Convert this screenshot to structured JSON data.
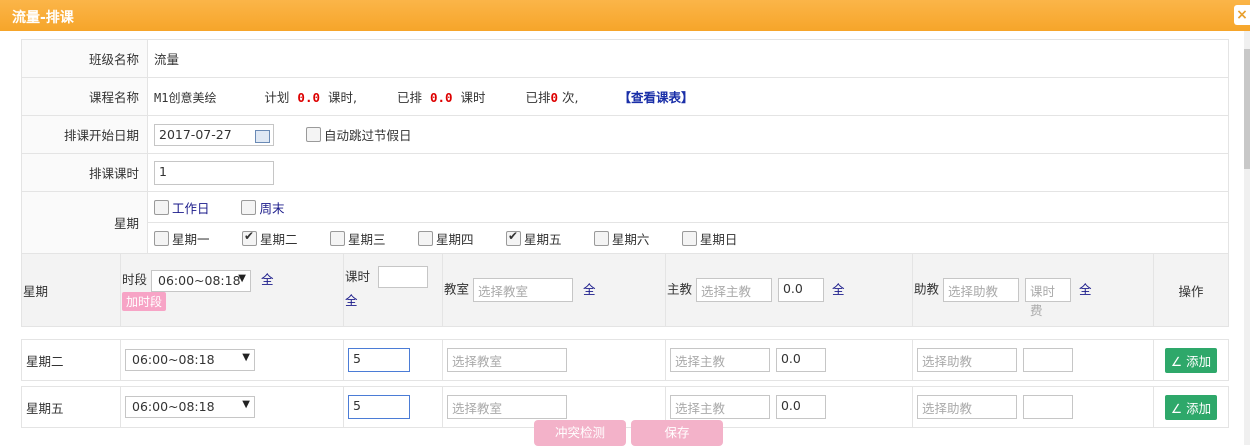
{
  "window": {
    "title": "流量-排课",
    "close": "×"
  },
  "form": {
    "class_name": {
      "label": "班级名称",
      "value": "流量"
    },
    "course": {
      "label": "课程名称",
      "course_value": "M1创意美绘",
      "plan_prefix": "计划",
      "plan_value": "0.0",
      "plan_suffix": "课时,",
      "done_prefix": "已排",
      "done_value": "0.0",
      "done_suffix": "课时",
      "count_prefix": "已排",
      "count_value": "0",
      "count_suffix": "次,",
      "view_link": "【查看课表】"
    },
    "start_date": {
      "label": "排课开始日期",
      "value": "2017-07-27",
      "skip_holiday": "自动跳过节假日"
    },
    "hours": {
      "label": "排课课时",
      "value": "1"
    },
    "week": {
      "label": "星期",
      "quick": [
        {
          "label": "工作日",
          "checked": false
        },
        {
          "label": "周末",
          "checked": false
        }
      ],
      "days": [
        {
          "label": "星期一",
          "checked": false
        },
        {
          "label": "星期二",
          "checked": true
        },
        {
          "label": "星期三",
          "checked": false
        },
        {
          "label": "星期四",
          "checked": false
        },
        {
          "label": "星期五",
          "checked": true
        },
        {
          "label": "星期六",
          "checked": false
        },
        {
          "label": "星期日",
          "checked": false
        }
      ]
    }
  },
  "grid": {
    "header": {
      "weekday": "星期",
      "period_label": "时段",
      "period_value": "06:00~08:18",
      "all": "全",
      "add_period": "加时段",
      "hours_label": "课时",
      "classroom_label": "教室",
      "classroom_ph": "选择教室",
      "teacher_label": "主教",
      "teacher_ph": "选择主教",
      "teacher_fee": "0.0",
      "assistant_label": "助教",
      "assistant_ph": "选择助教",
      "assistant_fee_ph": "课时费",
      "ops": "操作"
    },
    "rows": [
      {
        "weekday": "星期二",
        "period": "06:00~08:18",
        "hours": "5",
        "classroom_ph": "选择教室",
        "teacher_ph": "选择主教",
        "fee": "0.0",
        "assistant_ph": "选择助教",
        "add": "添加"
      },
      {
        "weekday": "星期五",
        "period": "06:00~08:18",
        "hours": "5",
        "classroom_ph": "选择教室",
        "teacher_ph": "选择主教",
        "fee": "0.0",
        "assistant_ph": "选择助教",
        "add": "添加"
      }
    ]
  },
  "buttons": {
    "check": "冲突检测",
    "save": "保存"
  }
}
